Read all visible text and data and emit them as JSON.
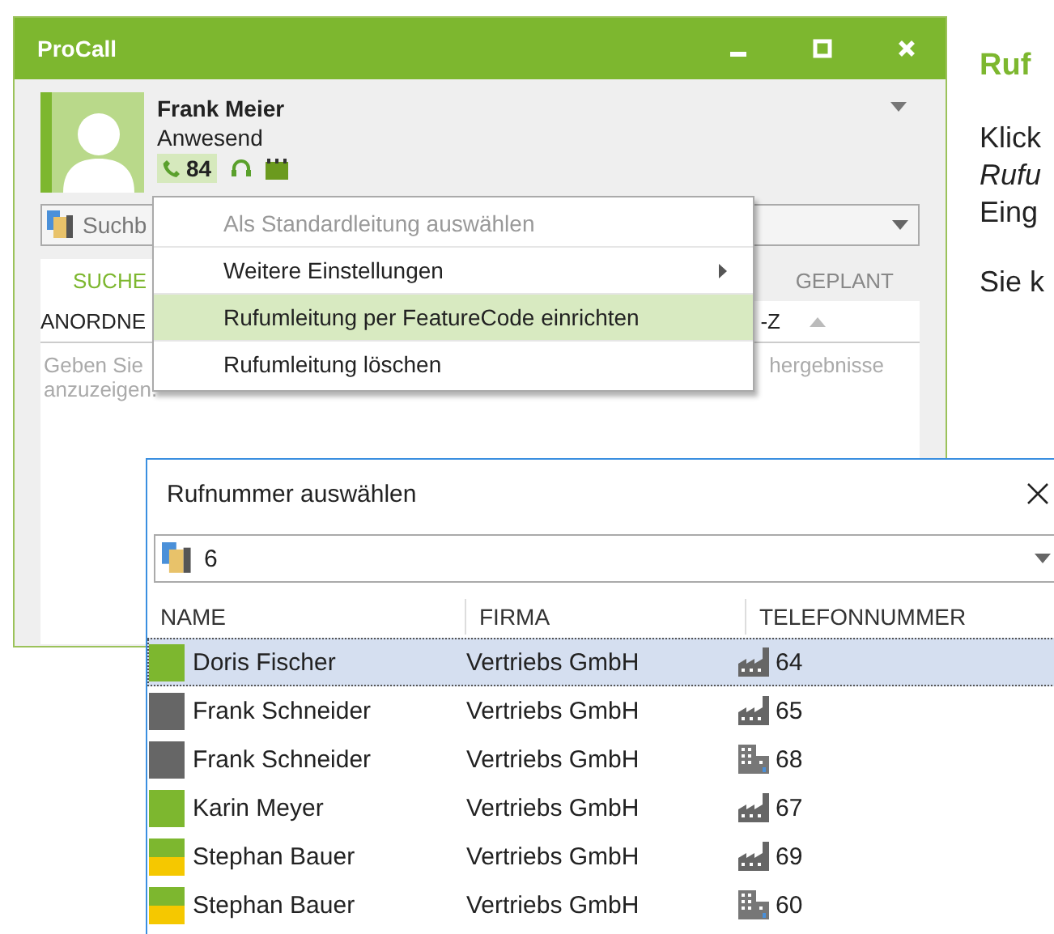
{
  "main_window": {
    "title": "ProCall",
    "user": {
      "name": "Frank Meier",
      "status_text": "Anwesend",
      "kind": "available",
      "line": "84"
    },
    "search": {
      "placeholder": "Suchb"
    },
    "tabs": [
      {
        "label": "SUCHE",
        "selected": true
      },
      {
        "label": "GEPLANT",
        "selected": false
      }
    ],
    "sort_bar": {
      "label": "ANORDNE",
      "order": "-Z"
    },
    "hint": {
      "line_1": "Geben Sie",
      "line_1_end": "hergebnisse",
      "line_2": "anzuzeigen."
    }
  },
  "context_menu": {
    "items": [
      {
        "label": "Als Standardleitung auswählen",
        "disabled": true,
        "submenu": false,
        "selected": false
      },
      {
        "label": "Weitere Einstellungen",
        "disabled": false,
        "submenu": true,
        "selected": false
      },
      {
        "label": "Rufumleitung per FeatureCode einrichten",
        "disabled": false,
        "submenu": false,
        "selected": true
      },
      {
        "label": "Rufumleitung löschen",
        "disabled": false,
        "submenu": false,
        "selected": false
      }
    ]
  },
  "document": {
    "heading": "Ruf",
    "lines": [
      {
        "text": "Klick",
        "italic": false
      },
      {
        "text": "Rufu",
        "italic": true
      },
      {
        "text": "Eing",
        "italic": false
      }
    ],
    "paragraph_2": "Sie k"
  },
  "dialog": {
    "title": "Rufnummer auswählen",
    "search": {
      "value": "6"
    },
    "columns": [
      "NAME",
      "FIRMA",
      "TELEFONNUMMER"
    ],
    "rows": [
      {
        "name": "Doris Fischer",
        "company": "Vertriebs GmbH",
        "number": {
          "value": "64",
          "kind": "work"
        },
        "kind": "available",
        "selected": true
      },
      {
        "name": "Frank Schneider",
        "company": "Vertriebs GmbH",
        "number": {
          "value": "65",
          "kind": "work"
        },
        "kind": "offline",
        "selected": false
      },
      {
        "name": "Frank Schneider",
        "company": "Vertriebs GmbH",
        "number": {
          "value": "68",
          "kind": "main"
        },
        "kind": "offline",
        "selected": false
      },
      {
        "name": "Karin Meyer",
        "company": "Vertriebs GmbH",
        "number": {
          "value": "67",
          "kind": "work"
        },
        "kind": "available",
        "selected": false
      },
      {
        "name": "Stephan Bauer",
        "company": "Vertriebs GmbH",
        "number": {
          "value": "69",
          "kind": "work"
        },
        "kind": "away",
        "selected": false
      },
      {
        "name": "Stephan Bauer",
        "company": "Vertriebs GmbH",
        "number": {
          "value": "60",
          "kind": "main"
        },
        "kind": "away",
        "selected": false
      }
    ]
  }
}
